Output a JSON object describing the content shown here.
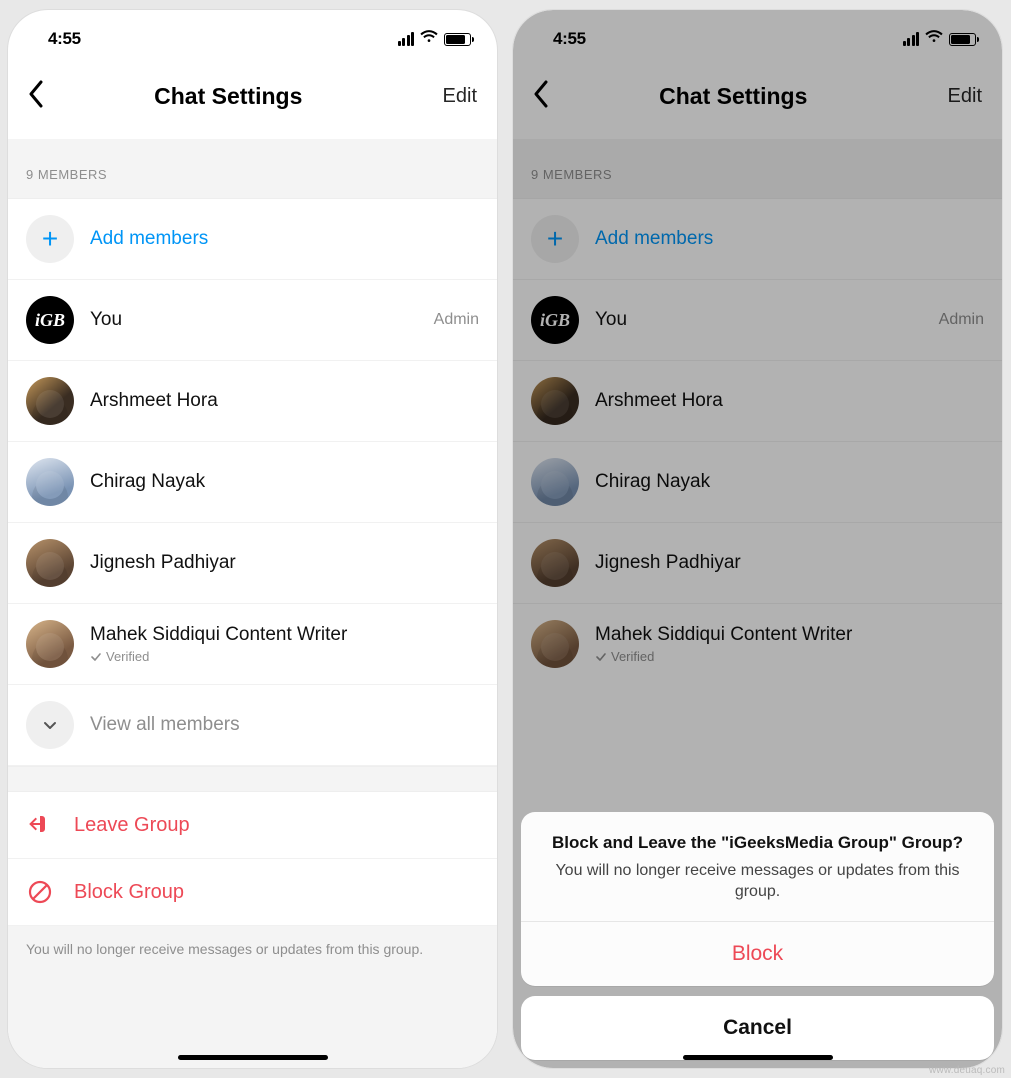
{
  "statusbar": {
    "time": "4:55"
  },
  "nav": {
    "title": "Chat Settings",
    "edit": "Edit"
  },
  "members": {
    "header": "9 MEMBERS",
    "add": "Add members",
    "viewAll": "View all members",
    "items": [
      {
        "name": "You",
        "right": "Admin",
        "avatar": "igb"
      },
      {
        "name": "Arshmeet Hora"
      },
      {
        "name": "Chirag Nayak"
      },
      {
        "name": "Jignesh Padhiyar"
      },
      {
        "name": "Mahek Siddiqui Content Writer",
        "verified": "Verified"
      }
    ]
  },
  "actions": {
    "leave": "Leave Group",
    "block": "Block Group"
  },
  "footer": "You will no longer receive messages or updates from this group.",
  "sheet": {
    "title": "Block and Leave the \"iGeeksMedia Group\" Group?",
    "desc": "You will no longer receive messages or updates from this group.",
    "block": "Block",
    "cancel": "Cancel"
  },
  "watermark": "www.deuaq.com"
}
